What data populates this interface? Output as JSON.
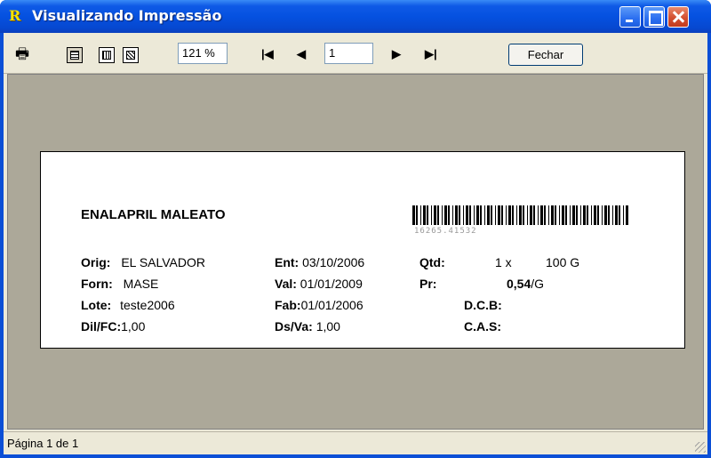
{
  "window": {
    "title": "Visualizando Impressão",
    "app_icon": "R"
  },
  "toolbar": {
    "zoom_value": "121 %",
    "page_value": "1",
    "first_glyph": "|◀",
    "prev_glyph": "◀",
    "next_glyph": "▶",
    "last_glyph": "▶|",
    "close_label": "Fechar"
  },
  "label": {
    "product_name": "ENALAPRIL MALEATO",
    "barcode_number": "16265.41532",
    "fields": {
      "orig_label": "Orig:",
      "orig_value": "EL SALVADOR",
      "forn_label": "Forn:",
      "forn_value": "MASE",
      "lote_label": "Lote:",
      "lote_value": "teste2006",
      "dil_label": "Dil/FC:",
      "dil_value": "1,00",
      "ent_label": "Ent:",
      "ent_value": "03/10/2006",
      "val_label": "Val:",
      "val_value": "01/01/2009",
      "fab_label": "Fab:",
      "fab_value": "01/01/2006",
      "dsva_label": "Ds/Va:",
      "dsva_value": "1,00",
      "qtd_label": "Qtd:",
      "qtd_mult": "1 x",
      "qtd_value": "100 G",
      "pr_label": "Pr:",
      "pr_value": "0,54",
      "pr_unit": "/G",
      "dcb_label": "D.C.B:",
      "cas_label": "C.A.S:"
    }
  },
  "status": {
    "page_info": "Página 1 de 1"
  },
  "icons": {
    "print": "printer-icon",
    "single_page": "single-page-icon",
    "two_page": "two-page-icon",
    "multi_page": "multi-page-icon"
  }
}
